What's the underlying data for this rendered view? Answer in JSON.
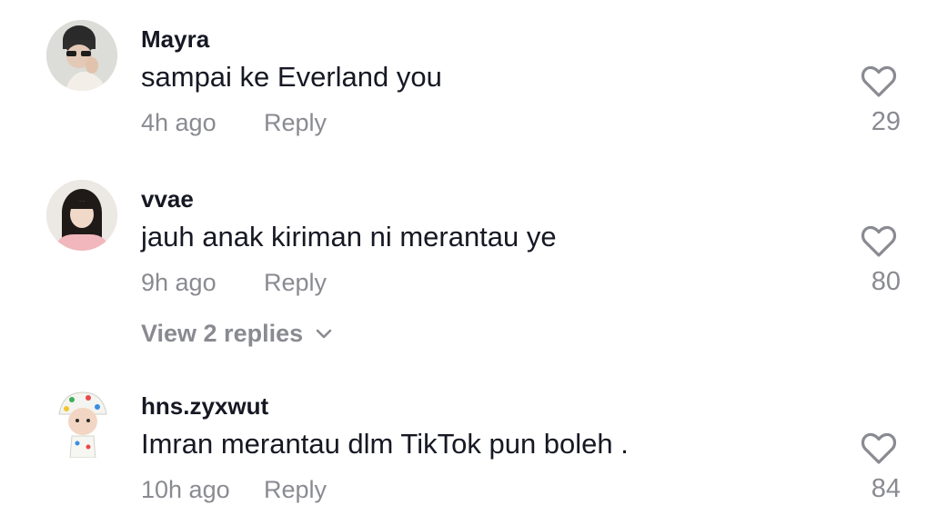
{
  "comments": [
    {
      "username": "Mayra",
      "text": "sampai ke Everland you",
      "time": "4h ago",
      "reply_label": "Reply",
      "likes": "29",
      "avatar_icon": "user-avatar-beanie"
    },
    {
      "username": "vvae",
      "text": "jauh anak kiriman ni merantau ye",
      "time": "9h ago",
      "reply_label": "Reply",
      "likes": "80",
      "view_replies_label": "View 2 replies",
      "avatar_icon": "user-avatar-girl"
    },
    {
      "username": "hns.zyxwut",
      "text": "Imran merantau dlm TikTok pun boleh .",
      "time": "10h ago",
      "reply_label": "Reply",
      "likes": "84",
      "avatar_icon": "user-avatar-baby"
    }
  ],
  "colors": {
    "primary_text": "#161823",
    "secondary_text": "#8a8b91",
    "icon_stroke": "#8a8b91"
  }
}
